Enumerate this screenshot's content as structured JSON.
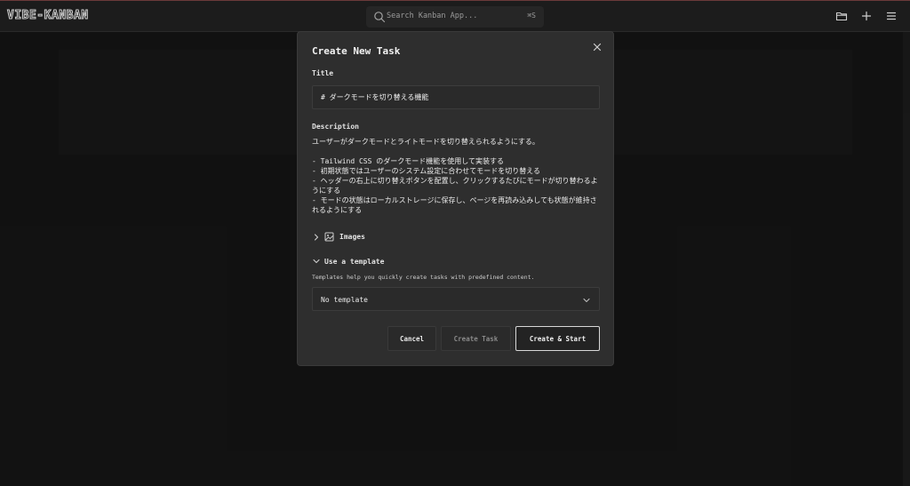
{
  "app": {
    "logo": "VIBE-KANBAN",
    "search": {
      "placeholder": "Search Kanban App...",
      "shortcut": "⌘S"
    },
    "icons": [
      "folder-icon",
      "plus-icon",
      "menu-icon"
    ]
  },
  "modal": {
    "title": "Create New Task",
    "title_label": "Title",
    "title_value": "# ダークモードを切り替える機能",
    "description_label": "Description",
    "description_value": "ユーザーがダークモードとライトモードを切り替えられるようにする。\n\n- Tailwind CSS のダークモード機能を使用して実装する\n- 初期状態ではユーザーのシステム設定に合わせてモードを切り替える\n- ヘッダーの右上に切り替えボタンを配置し、クリックするたびにモードが切り替わるようにする\n- モードの状態はローカルストレージに保存し、ページを再読み込みしても状態が維持されるようにする",
    "images_label": "Images",
    "template_label": "Use a template",
    "template_hint": "Templates help you quickly create tasks with predefined content.",
    "template_select": "No template",
    "buttons": {
      "cancel": "Cancel",
      "create": "Create Task",
      "create_start": "Create & Start"
    }
  },
  "colors": {
    "background": "#161616",
    "modal": "#2e2e2e",
    "accent_border": "#d8d8d8"
  }
}
